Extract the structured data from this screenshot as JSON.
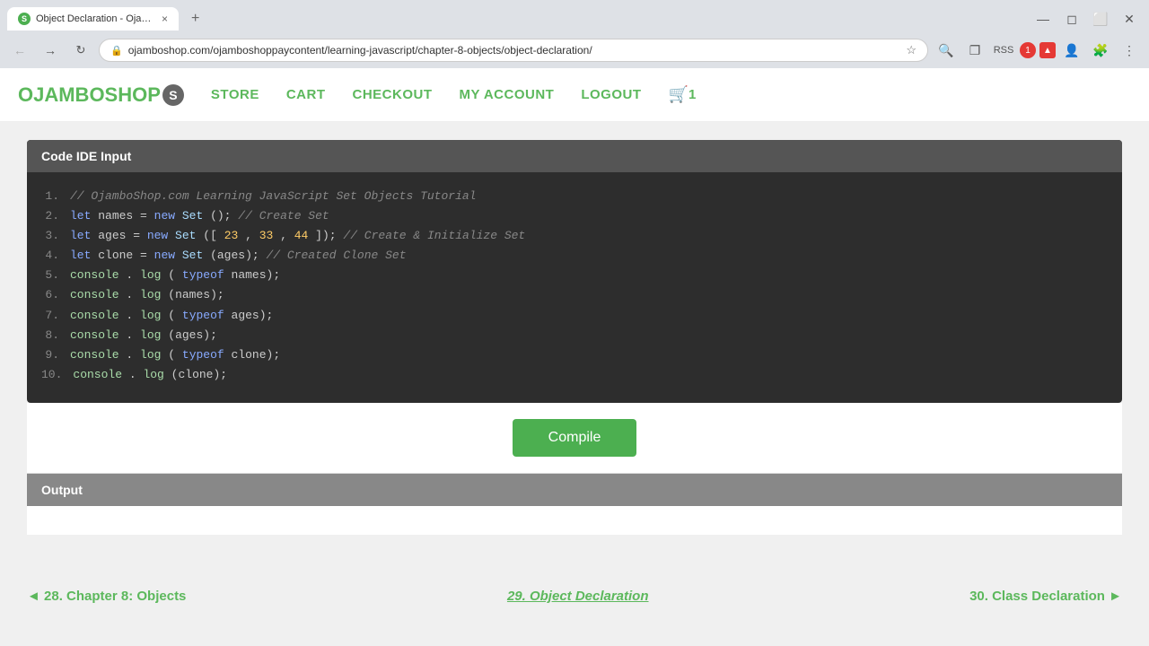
{
  "browser": {
    "tab_title": "Object Declaration - Ojamb...",
    "tab_favicon_label": "S",
    "url": "ojamboshop.com/ojamboshoppaycontent/learning-javascript/chapter-8-objects/object-declaration/",
    "new_tab_label": "+",
    "close_label": "×"
  },
  "nav": {
    "logo": "OJAMBOSHOP",
    "logo_badge": "S",
    "store": "STORE",
    "cart": "CART",
    "checkout": "CHECKOUT",
    "my_account": "MY ACCOUNT",
    "logout": "LOGOUT",
    "cart_count": "1"
  },
  "code_ide": {
    "header": "Code IDE Input",
    "lines": [
      {
        "num": "1.",
        "code": "// OjamboShop.com Learning JavaScript Set Objects Tutorial"
      },
      {
        "num": "2.",
        "code": "let names = new Set(); // Create Set"
      },
      {
        "num": "3.",
        "code": "let ages = new Set([23, 33, 44]); // Create & Initialize Set"
      },
      {
        "num": "4.",
        "code": "let clone = new Set(ages); // Created Clone Set"
      },
      {
        "num": "5.",
        "code": "console.log(typeof names);"
      },
      {
        "num": "6.",
        "code": "console.log(names);"
      },
      {
        "num": "7.",
        "code": "console.log(typeof ages);"
      },
      {
        "num": "8.",
        "code": "console.log(ages);"
      },
      {
        "num": "9.",
        "code": "console.log(typeof clone);"
      },
      {
        "num": "10.",
        "code": "console.log(clone);"
      }
    ]
  },
  "compile_button": "Compile",
  "output": {
    "header": "Output",
    "content": ""
  },
  "footer_nav": {
    "prev_label": "◄ 28. Chapter 8: Objects",
    "current_label": "29. Object Declaration",
    "next_label": "30. Class Declaration ►"
  }
}
